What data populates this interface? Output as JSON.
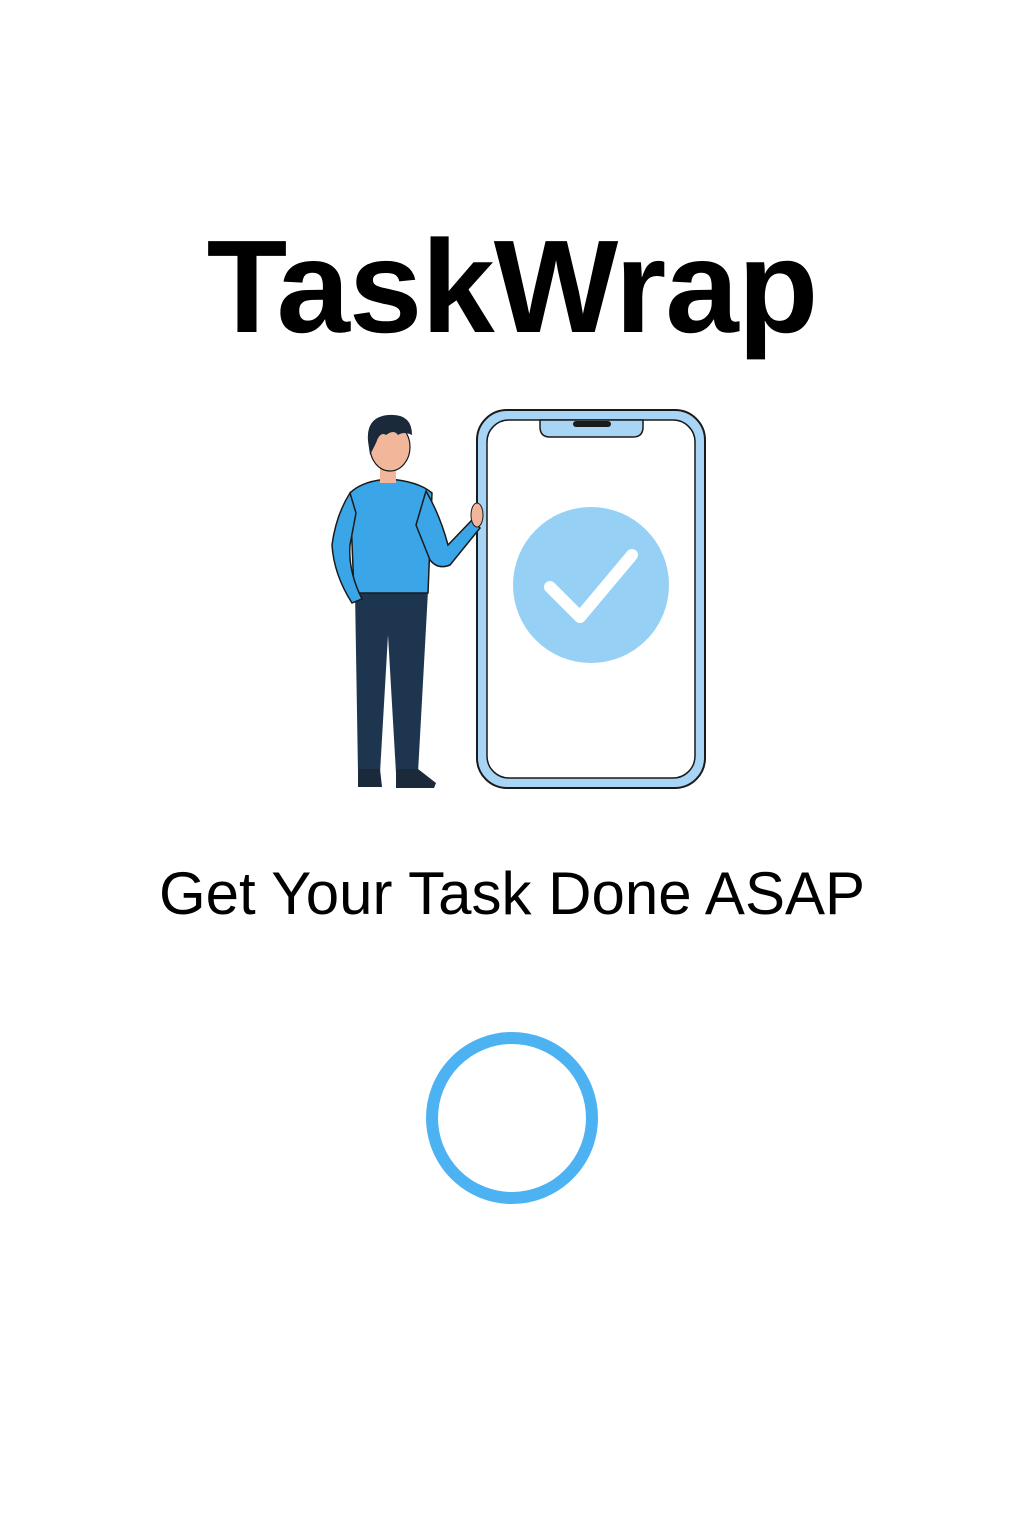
{
  "app": {
    "title": "TaskWrap",
    "tagline": "Get Your Task Done ASAP"
  },
  "illustration": {
    "subject": "person-with-phone-checkmark",
    "icon": "checkmark-icon"
  },
  "loading": {
    "icon": "loading-spinner-icon"
  },
  "colors": {
    "background": "#ffffff",
    "text": "#000000",
    "accent": "#4db2f2",
    "phone_frame": "#a8d4f5",
    "check_circle": "#96d1f5",
    "shirt": "#3aa6e8",
    "pants": "#1e3550",
    "skin": "#f2b79a",
    "hair": "#1a2a3a"
  }
}
